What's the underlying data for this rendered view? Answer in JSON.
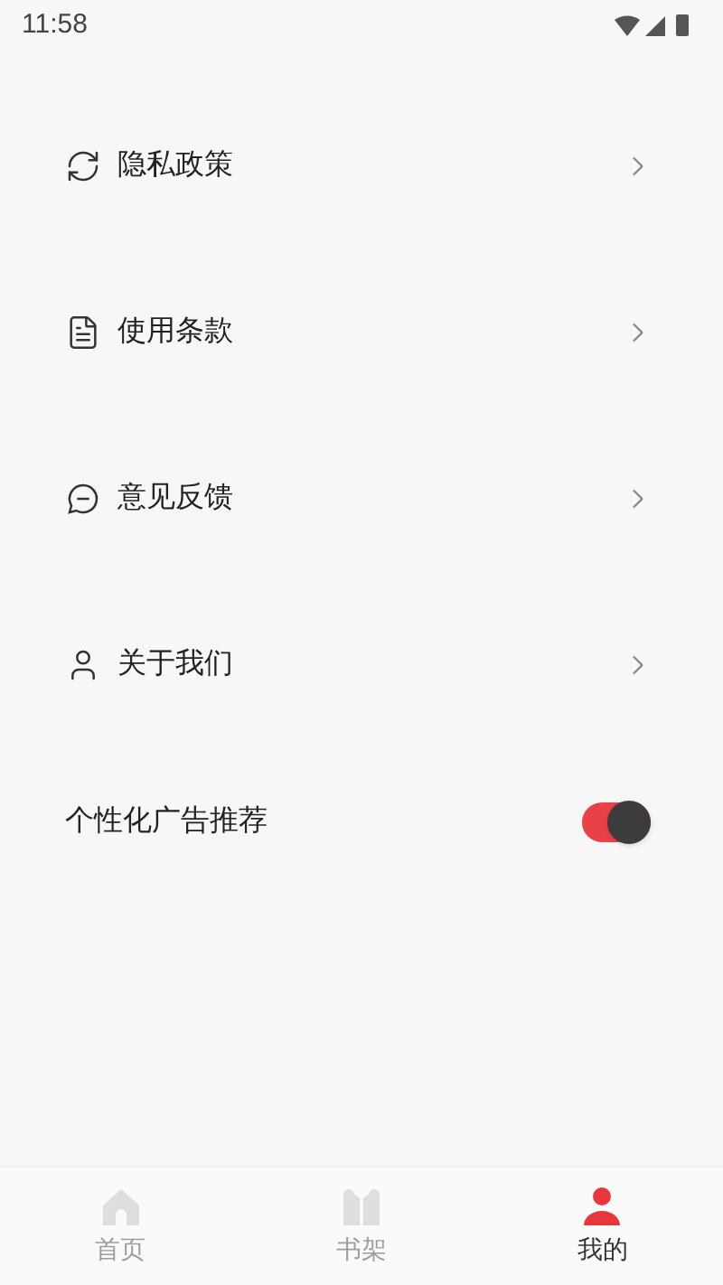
{
  "status_bar": {
    "time": "11:58"
  },
  "menu_items": [
    {
      "label": "隐私政策",
      "kind": "refresh"
    },
    {
      "label": "使用条款",
      "kind": "document"
    },
    {
      "label": "意见反馈",
      "kind": "chat"
    },
    {
      "label": "关于我们",
      "kind": "person"
    }
  ],
  "toggle_row": {
    "label": "个性化广告推荐",
    "on": true
  },
  "bottom_nav": [
    {
      "label": "首页",
      "kind": "home",
      "selected": false
    },
    {
      "label": "书架",
      "kind": "books",
      "selected": false
    },
    {
      "label": "我的",
      "kind": "person",
      "selected": true
    }
  ]
}
